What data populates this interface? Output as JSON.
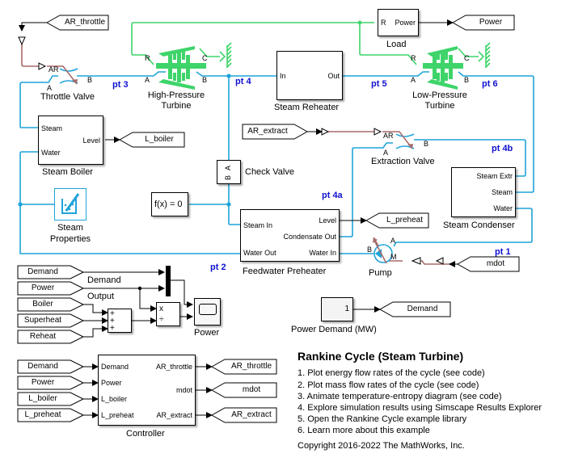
{
  "colors": {
    "fluid_line": "#1fa3d9",
    "mech_line": "#3ed46a",
    "signal_line": "#000000",
    "control_line": "#a86a6a",
    "point_label": "#1010d0"
  },
  "blocks": {
    "throttle_valve": {
      "label": "Throttle Valve",
      "ports": {
        "ar": "AR",
        "a": "A",
        "b": "B"
      }
    },
    "hp_turbine": {
      "label": "High-Pressure Turbine",
      "label_line1": "High-Pressure",
      "label_line2": "Turbine",
      "ports": {
        "r": "R",
        "c": "C",
        "a": "A",
        "b": "B"
      }
    },
    "steam_reheater": {
      "label": "Steam Reheater",
      "ports": {
        "in": "In",
        "out": "Out"
      }
    },
    "load": {
      "label": "Load",
      "ports": {
        "r": "R",
        "power": "Power"
      }
    },
    "lp_turbine": {
      "label": "Low-Pressure Turbine",
      "label_line1": "Low-Pressure",
      "label_line2": "Turbine",
      "ports": {
        "r": "R",
        "c": "C",
        "a": "A",
        "b": "B"
      }
    },
    "steam_boiler": {
      "label": "Steam Boiler",
      "ports": {
        "steam": "Steam",
        "water": "Water",
        "level": "Level"
      }
    },
    "steam_properties": {
      "label": "Steam Properties",
      "label_line1": "Steam",
      "label_line2": "Properties"
    },
    "check_valve": {
      "label": "Check Valve",
      "ports": {
        "a": "A",
        "b": "B"
      }
    },
    "solver_config": {
      "label": "f(x) = 0"
    },
    "extraction_valve": {
      "label": "Extraction Valve",
      "ports": {
        "ar": "AR",
        "a": "A",
        "b": "B"
      }
    },
    "steam_condenser": {
      "label": "Steam Condenser",
      "ports": {
        "steam_extr": "Steam Extr",
        "steam": "Steam",
        "water": "Water"
      }
    },
    "feedwater_preheater": {
      "label": "Feedwater Preheater",
      "ports": {
        "steam_in": "Steam In",
        "level": "Level",
        "condensate_out": "Condensate Out",
        "water_out": "Water Out",
        "water_in": "Water In"
      }
    },
    "pump": {
      "label": "Pump",
      "ports": {
        "a": "A",
        "b": "B",
        "m": "M"
      }
    },
    "power_demand": {
      "label": "Power Demand (MW)",
      "value": "1"
    },
    "scope": {
      "label": "Power"
    },
    "sum": {
      "signs": [
        "+",
        "+",
        "+"
      ]
    },
    "divide": {
      "ops": [
        "x",
        "÷"
      ]
    },
    "controller": {
      "label": "Controller",
      "inputs": [
        "Demand",
        "Power",
        "L_boiler",
        "L_preheat"
      ],
      "outputs": [
        "AR_throttle",
        "mdot",
        "AR_extract"
      ]
    }
  },
  "signal_labels": {
    "demand": "Demand",
    "output": "Output"
  },
  "goto_tags": {
    "ar_throttle_from": "AR_throttle",
    "power_goto": "Power",
    "l_boiler_goto": "L_boiler",
    "ar_extract_from": "AR_extract",
    "l_preheat_goto": "L_preheat",
    "mdot_from": "mdot",
    "demand_goto": "Demand",
    "scope_from": [
      "Demand",
      "Power",
      "Boiler",
      "Superheat",
      "Reheat"
    ],
    "controller_from": [
      "Demand",
      "Power",
      "L_boiler",
      "L_preheat"
    ],
    "controller_goto": [
      "AR_throttle",
      "mdot",
      "AR_extract"
    ]
  },
  "points": {
    "pt1": "pt 1",
    "pt2": "pt 2",
    "pt3": "pt 3",
    "pt4": "pt 4",
    "pt4a": "pt 4a",
    "pt4b": "pt 4b",
    "pt5": "pt 5",
    "pt6": "pt 6"
  },
  "annotation": {
    "title": "Rankine Cycle (Steam Turbine)",
    "links": [
      "1. Plot energy flow rates of the cycle (see code)",
      "2. Plot mass flow rates of the cycle (see code)",
      "3. Animate temperature-entropy diagram (see code)",
      "4. Explore simulation results using Simscape Results Explorer",
      "5. Open the Rankine Cycle example library",
      "6. Learn more about this example"
    ],
    "copyright": "Copyright 2016-2022 The MathWorks, Inc."
  }
}
